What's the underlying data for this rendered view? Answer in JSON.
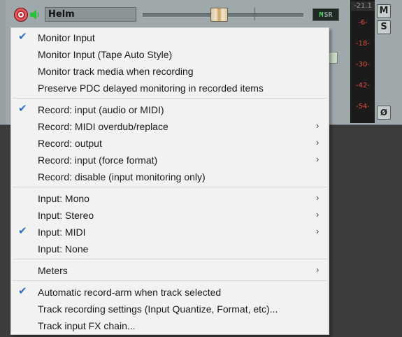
{
  "track": {
    "name": "Helm",
    "msr": {
      "m": "M",
      "sr": "SR"
    },
    "meter_readout": "-21.1",
    "meter_marks": [
      "-6-",
      "-18-",
      "-30-",
      "-42-",
      "-54-"
    ],
    "mute_label": "M",
    "solo_label": "S",
    "phase_label": "Ø",
    "colors": {
      "panel": "#9fa8ab",
      "rec": "#c12a33",
      "monitor": "#2bbf3a",
      "meter_text": "#e05040"
    }
  },
  "menu": {
    "items": [
      {
        "label": "Monitor Input",
        "checked": true,
        "submenu": false
      },
      {
        "label": "Monitor Input (Tape Auto Style)",
        "checked": false,
        "submenu": false
      },
      {
        "label": "Monitor track media when recording",
        "checked": false,
        "submenu": false
      },
      {
        "label": "Preserve PDC delayed monitoring in recorded items",
        "checked": false,
        "submenu": false
      },
      {
        "label": "Record: input (audio or MIDI)",
        "checked": true,
        "submenu": false
      },
      {
        "label": "Record: MIDI overdub/replace",
        "checked": false,
        "submenu": true
      },
      {
        "label": "Record: output",
        "checked": false,
        "submenu": true
      },
      {
        "label": "Record: input (force format)",
        "checked": false,
        "submenu": true
      },
      {
        "label": "Record: disable (input monitoring only)",
        "checked": false,
        "submenu": false
      },
      {
        "label": "Input: Mono",
        "checked": false,
        "submenu": true
      },
      {
        "label": "Input: Stereo",
        "checked": false,
        "submenu": true
      },
      {
        "label": "Input: MIDI",
        "checked": true,
        "submenu": true
      },
      {
        "label": "Input: None",
        "checked": false,
        "submenu": false
      },
      {
        "label": "Meters",
        "checked": false,
        "submenu": true
      },
      {
        "label": "Automatic record-arm when track selected",
        "checked": true,
        "submenu": false
      },
      {
        "label": "Track recording settings (Input Quantize, Format, etc)...",
        "checked": false,
        "submenu": false
      },
      {
        "label": "Track input FX chain...",
        "checked": false,
        "submenu": false
      }
    ],
    "check_glyph": "✔",
    "arrow_glyph": "›"
  }
}
